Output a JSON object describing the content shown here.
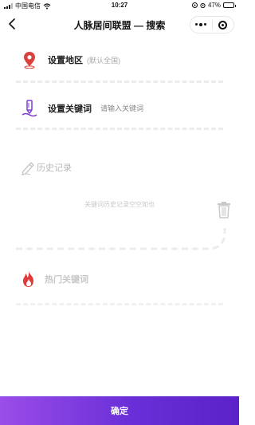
{
  "status_bar": {
    "carrier": "中国电信",
    "time": "10:27",
    "battery_percent": "47%",
    "battery_level": 0.47
  },
  "nav": {
    "title": "人脉居间联盟 — 搜索"
  },
  "region": {
    "label": "设置地区",
    "hint": "(默认全国)"
  },
  "keyword": {
    "label": "设置关键词",
    "placeholder": "请输入关键词"
  },
  "history": {
    "title": "历史记录",
    "empty_text": "关键词历史记录空空如也"
  },
  "hot": {
    "title": "热门关键词"
  },
  "confirm_label": "确定",
  "colors": {
    "accent_start": "#9a4de8",
    "accent_end": "#5a22c8",
    "pin_red": "#d9423a",
    "fire_red": "#e03a3a"
  }
}
